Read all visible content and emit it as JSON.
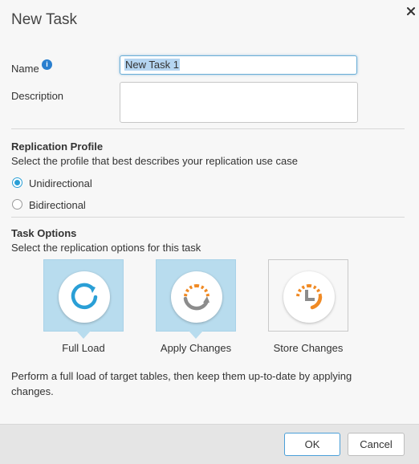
{
  "dialog": {
    "title": "New Task"
  },
  "form": {
    "name_label": "Name",
    "name_value": "New Task 1",
    "description_label": "Description",
    "description_value": ""
  },
  "replication_profile": {
    "title": "Replication Profile",
    "subtitle": "Select the profile that best describes your replication use case",
    "options": [
      {
        "label": "Unidirectional",
        "checked": true
      },
      {
        "label": "Bidirectional",
        "checked": false
      }
    ]
  },
  "task_options": {
    "title": "Task Options",
    "subtitle": "Select the replication options for this task",
    "items": [
      {
        "label": "Full Load",
        "selected": true,
        "icon": "full-load-icon"
      },
      {
        "label": "Apply Changes",
        "selected": true,
        "icon": "apply-changes-icon"
      },
      {
        "label": "Store Changes",
        "selected": false,
        "icon": "store-changes-icon"
      }
    ],
    "description": "Perform a full load of target tables, then keep them up-to-date by applying changes."
  },
  "footer": {
    "ok_label": "OK",
    "cancel_label": "Cancel"
  },
  "colors": {
    "accent": "#2a9fd6",
    "tile_selected": "#b8dcee",
    "orange": "#f08a24",
    "gray": "#8c8c8c"
  }
}
